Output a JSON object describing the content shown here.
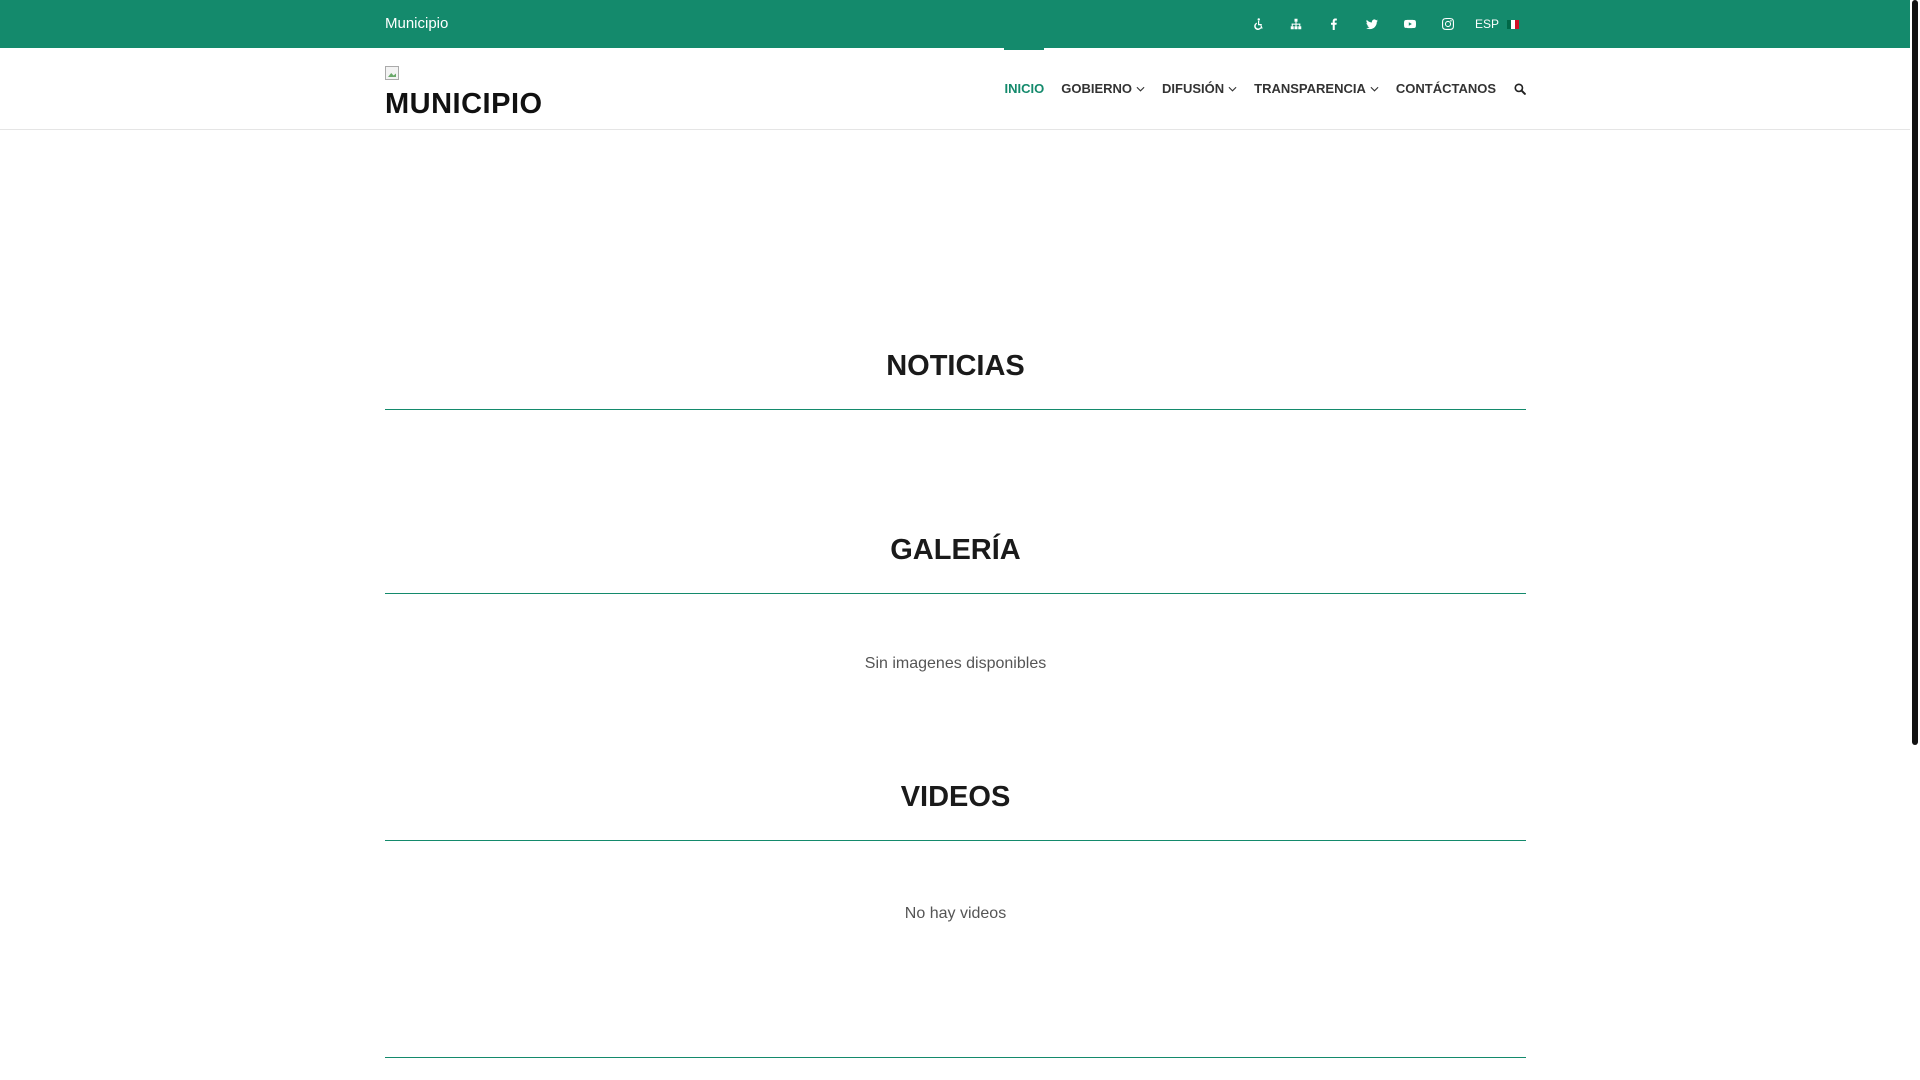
{
  "topbar": {
    "site_name": "Municipio",
    "icons": [
      {
        "name": "accessibility-icon"
      },
      {
        "name": "sitemap-icon"
      },
      {
        "name": "facebook-icon"
      },
      {
        "name": "twitter-icon"
      },
      {
        "name": "youtube-icon"
      },
      {
        "name": "instagram-icon"
      }
    ],
    "language": "ESP",
    "flag_colors": [
      "#006847",
      "#ffffff",
      "#ce1126"
    ]
  },
  "header": {
    "logo_text": "MUNICIPIO",
    "nav": [
      {
        "label": "INICIO",
        "active": true,
        "dropdown": false
      },
      {
        "label": "GOBIERNO",
        "active": false,
        "dropdown": true
      },
      {
        "label": "DIFUSIÓN",
        "active": false,
        "dropdown": true
      },
      {
        "label": "TRANSPARENCIA",
        "active": false,
        "dropdown": true
      },
      {
        "label": "CONTÁCTANOS",
        "active": false,
        "dropdown": false
      }
    ]
  },
  "sections": {
    "news": {
      "title": "NOTICIAS"
    },
    "gallery": {
      "title": "GALERÍA",
      "empty_message": "Sin imagenes disponibles"
    },
    "videos": {
      "title": "VIDEOS",
      "empty_message": "No hay videos"
    }
  },
  "colors": {
    "accent": "#148a6c"
  }
}
